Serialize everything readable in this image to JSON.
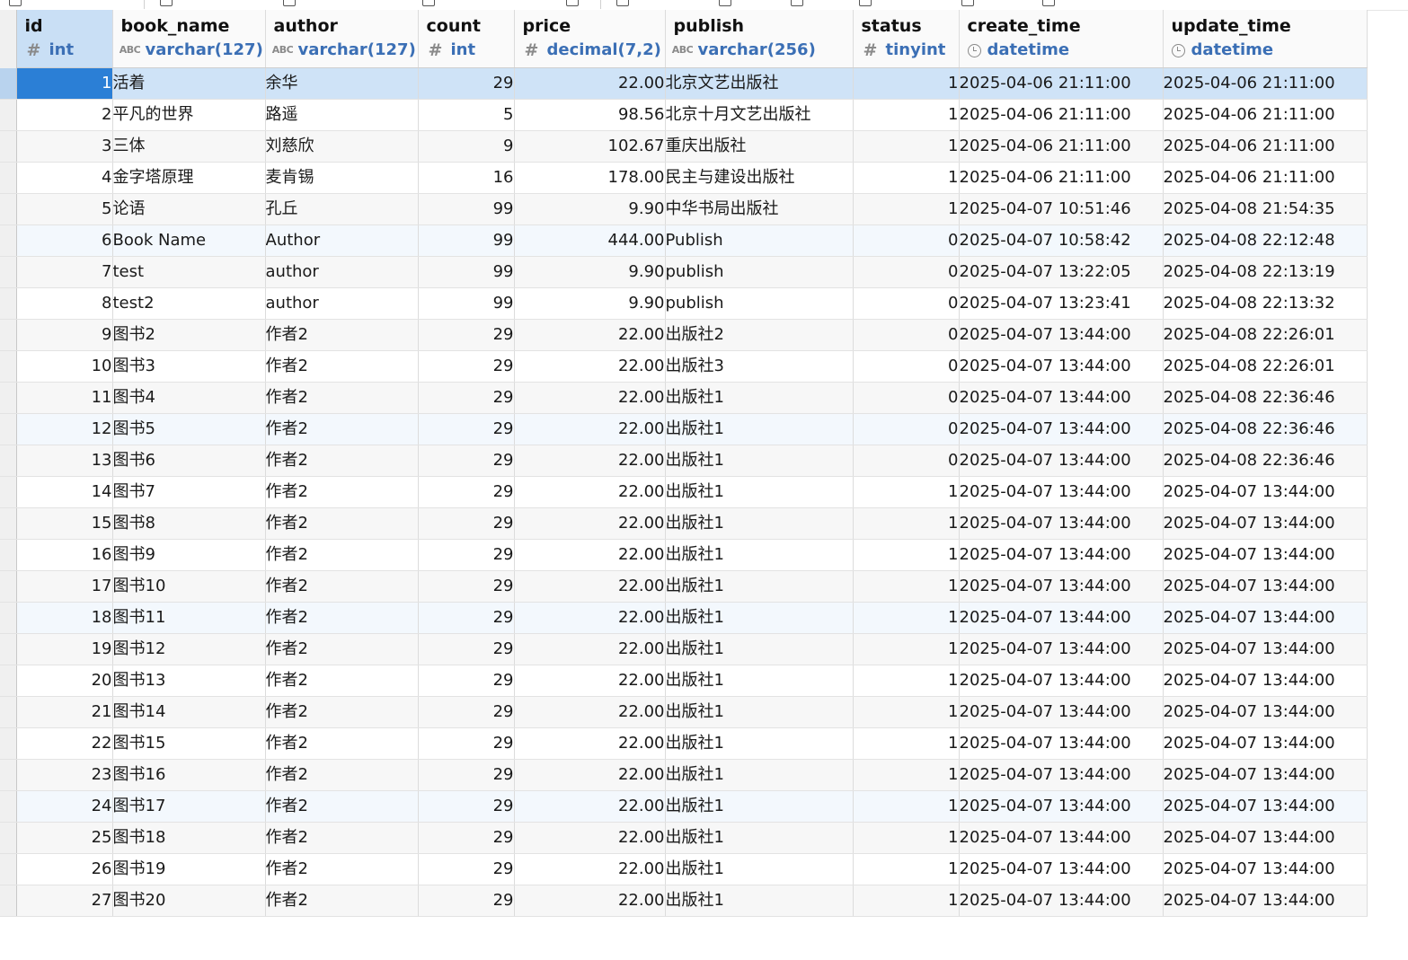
{
  "columns": [
    {
      "name": "id",
      "type": "int",
      "icon": "hash-icon"
    },
    {
      "name": "book_name",
      "type": "varchar(127)",
      "icon": "abc-icon"
    },
    {
      "name": "author",
      "type": "varchar(127)",
      "icon": "abc-icon"
    },
    {
      "name": "count",
      "type": "int",
      "icon": "hash-icon"
    },
    {
      "name": "price",
      "type": "decimal(7,2)",
      "icon": "hash-icon"
    },
    {
      "name": "publish",
      "type": "varchar(256)",
      "icon": "abc-icon"
    },
    {
      "name": "status",
      "type": "tinyint",
      "icon": "hash-icon"
    },
    {
      "name": "create_time",
      "type": "datetime",
      "icon": "clock-icon"
    },
    {
      "name": "update_time",
      "type": "datetime",
      "icon": "clock-icon"
    }
  ],
  "rows": [
    [
      "1",
      "活着",
      "余华",
      "29",
      "22.00",
      "北京文艺出版社",
      "1",
      "2025-04-06 21:11:00",
      "2025-04-06 21:11:00"
    ],
    [
      "2",
      "平凡的世界",
      "路遥",
      "5",
      "98.56",
      "北京十月文艺出版社",
      "1",
      "2025-04-06 21:11:00",
      "2025-04-06 21:11:00"
    ],
    [
      "3",
      "三体",
      "刘慈欣",
      "9",
      "102.67",
      "重庆出版社",
      "1",
      "2025-04-06 21:11:00",
      "2025-04-06 21:11:00"
    ],
    [
      "4",
      "金字塔原理",
      "麦肯锡",
      "16",
      "178.00",
      "民主与建设出版社",
      "1",
      "2025-04-06 21:11:00",
      "2025-04-06 21:11:00"
    ],
    [
      "5",
      "论语",
      "孔丘",
      "99",
      "9.90",
      "中华书局出版社",
      "1",
      "2025-04-07 10:51:46",
      "2025-04-08 21:54:35"
    ],
    [
      "6",
      "Book Name",
      "Author",
      "99",
      "444.00",
      "Publish",
      "0",
      "2025-04-07 10:58:42",
      "2025-04-08 22:12:48"
    ],
    [
      "7",
      "test",
      "author",
      "99",
      "9.90",
      "publish",
      "0",
      "2025-04-07 13:22:05",
      "2025-04-08 22:13:19"
    ],
    [
      "8",
      "test2",
      "author",
      "99",
      "9.90",
      "publish",
      "0",
      "2025-04-07 13:23:41",
      "2025-04-08 22:13:32"
    ],
    [
      "9",
      "图书2",
      "作者2",
      "29",
      "22.00",
      "出版社2",
      "0",
      "2025-04-07 13:44:00",
      "2025-04-08 22:26:01"
    ],
    [
      "10",
      "图书3",
      "作者2",
      "29",
      "22.00",
      "出版社3",
      "0",
      "2025-04-07 13:44:00",
      "2025-04-08 22:26:01"
    ],
    [
      "11",
      "图书4",
      "作者2",
      "29",
      "22.00",
      "出版社1",
      "0",
      "2025-04-07 13:44:00",
      "2025-04-08 22:36:46"
    ],
    [
      "12",
      "图书5",
      "作者2",
      "29",
      "22.00",
      "出版社1",
      "0",
      "2025-04-07 13:44:00",
      "2025-04-08 22:36:46"
    ],
    [
      "13",
      "图书6",
      "作者2",
      "29",
      "22.00",
      "出版社1",
      "0",
      "2025-04-07 13:44:00",
      "2025-04-08 22:36:46"
    ],
    [
      "14",
      "图书7",
      "作者2",
      "29",
      "22.00",
      "出版社1",
      "1",
      "2025-04-07 13:44:00",
      "2025-04-07 13:44:00"
    ],
    [
      "15",
      "图书8",
      "作者2",
      "29",
      "22.00",
      "出版社1",
      "1",
      "2025-04-07 13:44:00",
      "2025-04-07 13:44:00"
    ],
    [
      "16",
      "图书9",
      "作者2",
      "29",
      "22.00",
      "出版社1",
      "1",
      "2025-04-07 13:44:00",
      "2025-04-07 13:44:00"
    ],
    [
      "17",
      "图书10",
      "作者2",
      "29",
      "22.00",
      "出版社1",
      "1",
      "2025-04-07 13:44:00",
      "2025-04-07 13:44:00"
    ],
    [
      "18",
      "图书11",
      "作者2",
      "29",
      "22.00",
      "出版社1",
      "1",
      "2025-04-07 13:44:00",
      "2025-04-07 13:44:00"
    ],
    [
      "19",
      "图书12",
      "作者2",
      "29",
      "22.00",
      "出版社1",
      "1",
      "2025-04-07 13:44:00",
      "2025-04-07 13:44:00"
    ],
    [
      "20",
      "图书13",
      "作者2",
      "29",
      "22.00",
      "出版社1",
      "1",
      "2025-04-07 13:44:00",
      "2025-04-07 13:44:00"
    ],
    [
      "21",
      "图书14",
      "作者2",
      "29",
      "22.00",
      "出版社1",
      "1",
      "2025-04-07 13:44:00",
      "2025-04-07 13:44:00"
    ],
    [
      "22",
      "图书15",
      "作者2",
      "29",
      "22.00",
      "出版社1",
      "1",
      "2025-04-07 13:44:00",
      "2025-04-07 13:44:00"
    ],
    [
      "23",
      "图书16",
      "作者2",
      "29",
      "22.00",
      "出版社1",
      "1",
      "2025-04-07 13:44:00",
      "2025-04-07 13:44:00"
    ],
    [
      "24",
      "图书17",
      "作者2",
      "29",
      "22.00",
      "出版社1",
      "1",
      "2025-04-07 13:44:00",
      "2025-04-07 13:44:00"
    ],
    [
      "25",
      "图书18",
      "作者2",
      "29",
      "22.00",
      "出版社1",
      "1",
      "2025-04-07 13:44:00",
      "2025-04-07 13:44:00"
    ],
    [
      "26",
      "图书19",
      "作者2",
      "29",
      "22.00",
      "出版社1",
      "1",
      "2025-04-07 13:44:00",
      "2025-04-07 13:44:00"
    ],
    [
      "27",
      "图书20",
      "作者2",
      "29",
      "22.00",
      "出版社1",
      "1",
      "2025-04-07 13:44:00",
      "2025-04-07 13:44:00"
    ]
  ],
  "selected_row": 1,
  "active_cell": {
    "row": 1,
    "column": "id"
  },
  "colors": {
    "selection": "#cfe3f7",
    "active_cell": "#2b7fd6",
    "type_text": "#3b6fb5"
  }
}
